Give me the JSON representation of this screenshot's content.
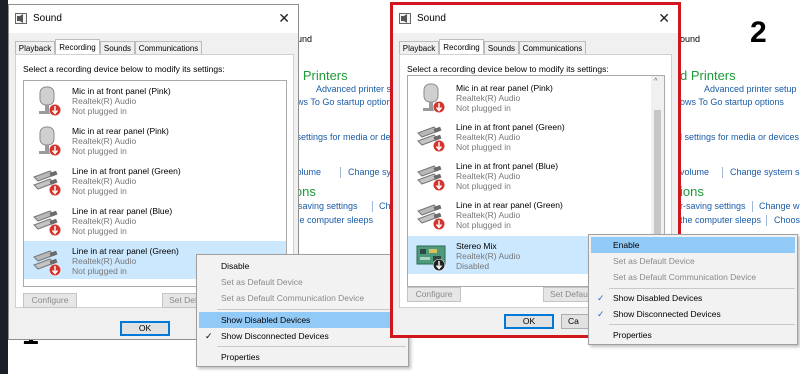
{
  "labels": {
    "one": "1",
    "two": "2"
  },
  "background_panels": [
    {
      "sound_heading": "ound",
      "section_title": "d Printers",
      "links": [
        "Advanced printer se",
        "ows To Go startup options",
        "l settings for media or devices",
        "volume",
        "Change sy",
        "r-saving settings",
        "Ch",
        "the computer sleeps"
      ],
      "section_title_2": "ions"
    },
    {
      "sound_heading": "ound",
      "section_title": "d Printers",
      "links": [
        "Advanced printer setup",
        "ows To Go startup options",
        "l settings for media or devices",
        "volume",
        "Change system so",
        "r-saving settings",
        "Change wh",
        "the computer sleeps",
        "Choos"
      ],
      "section_title_2": "ions"
    }
  ],
  "window1": {
    "title": "Sound",
    "close": "✕",
    "tabs": [
      "Playback",
      "Recording",
      "Sounds",
      "Communications"
    ],
    "hint": "Select a recording device below to modify its settings:",
    "devices": [
      {
        "name": "Mic in at front panel (Pink)",
        "driver": "Realtek(R) Audio",
        "status": "Not plugged in",
        "icon": "microphone-icon"
      },
      {
        "name": "Mic in at rear panel (Pink)",
        "driver": "Realtek(R) Audio",
        "status": "Not plugged in",
        "icon": "microphone-icon"
      },
      {
        "name": "Line in at front panel (Green)",
        "driver": "Realtek(R) Audio",
        "status": "Not plugged in",
        "icon": "audio-jack-icon"
      },
      {
        "name": "Line in at rear panel (Blue)",
        "driver": "Realtek(R) Audio",
        "status": "Not plugged in",
        "icon": "audio-jack-icon"
      },
      {
        "name": "Line in at rear panel (Green)",
        "driver": "Realtek(R) Audio",
        "status": "Not plugged in",
        "icon": "audio-jack-icon",
        "selected": true
      }
    ],
    "configure": "Configure",
    "set_default": "Set Defa",
    "ok": "OK",
    "menu": {
      "items": [
        {
          "label": "Disable",
          "state": "normal"
        },
        {
          "label": "Set as Default Device",
          "state": "gray"
        },
        {
          "label": "Set as Default Communication Device",
          "state": "gray"
        },
        {
          "label": "Show Disabled Devices",
          "state": "highlight",
          "checked": false
        },
        {
          "label": "Show Disconnected Devices",
          "state": "normal",
          "checked": true
        },
        {
          "label": "Properties",
          "state": "normal"
        }
      ],
      "checkmark": "✓"
    }
  },
  "window2": {
    "title": "Sound",
    "close": "✕",
    "tabs": [
      "Playback",
      "Recording",
      "Sounds",
      "Communications"
    ],
    "hint": "Select a recording device below to modify its settings:",
    "devices": [
      {
        "name": "Mic in at rear panel (Pink)",
        "driver": "Realtek(R) Audio",
        "status": "Not plugged in",
        "icon": "microphone-icon"
      },
      {
        "name": "Line in at front panel (Green)",
        "driver": "Realtek(R) Audio",
        "status": "Not plugged in",
        "icon": "audio-jack-icon"
      },
      {
        "name": "Line in at front panel (Blue)",
        "driver": "Realtek(R) Audio",
        "status": "Not plugged in",
        "icon": "audio-jack-icon"
      },
      {
        "name": "Line in at rear panel (Green)",
        "driver": "Realtek(R) Audio",
        "status": "Not plugged in",
        "icon": "audio-jack-icon"
      },
      {
        "name": "Stereo Mix",
        "driver": "Realtek(R) Audio",
        "status": "Disabled",
        "icon": "circuit-board-icon",
        "selected": true
      }
    ],
    "configure": "Configure",
    "set_default": "Set Defau",
    "ok": "OK",
    "cancel_partial": "Ca",
    "menu": {
      "items": [
        {
          "label": "Enable",
          "state": "highlight"
        },
        {
          "label": "Set as Default Device",
          "state": "gray"
        },
        {
          "label": "Set as Default Communication Device",
          "state": "gray"
        },
        {
          "label": "Show Disabled Devices",
          "state": "normal",
          "checked": true
        },
        {
          "label": "Show Disconnected Devices",
          "state": "normal",
          "checked": true
        },
        {
          "label": "Properties",
          "state": "normal"
        }
      ],
      "checkmark": "✓"
    }
  },
  "colors": {
    "accent_red": "#d0171d",
    "selection": "#cce8ff",
    "menu_highlight": "#91c9f7",
    "link": "#1a5ba8",
    "cp_green": "#1e9a38"
  }
}
